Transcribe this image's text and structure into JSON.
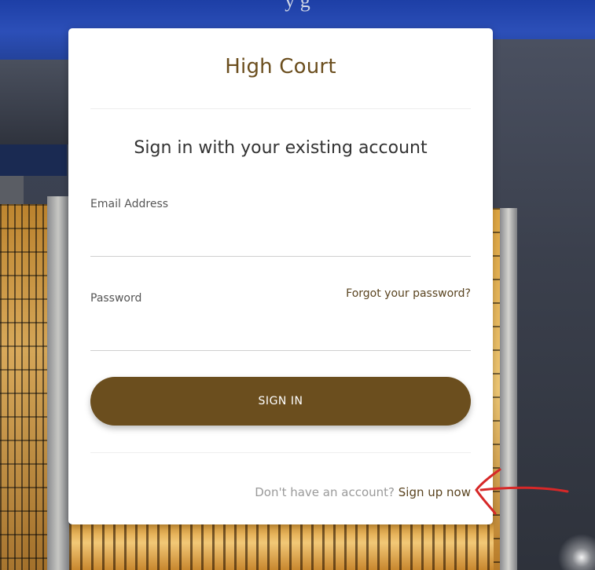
{
  "page": {
    "partial_top_text": "y      g"
  },
  "card": {
    "brand": "High Court",
    "heading": "Sign in with your existing account",
    "email": {
      "label": "Email Address",
      "value": "",
      "placeholder": ""
    },
    "password": {
      "label": "Password",
      "value": "",
      "placeholder": ""
    },
    "forgot_password_link": "Forgot your password?",
    "sign_in_button": "SIGN IN",
    "signup_prompt": "Don't have an account? ",
    "signup_link": "Sign up now"
  },
  "colors": {
    "brand": "#6b4e1e",
    "annotation": "#d62828"
  }
}
